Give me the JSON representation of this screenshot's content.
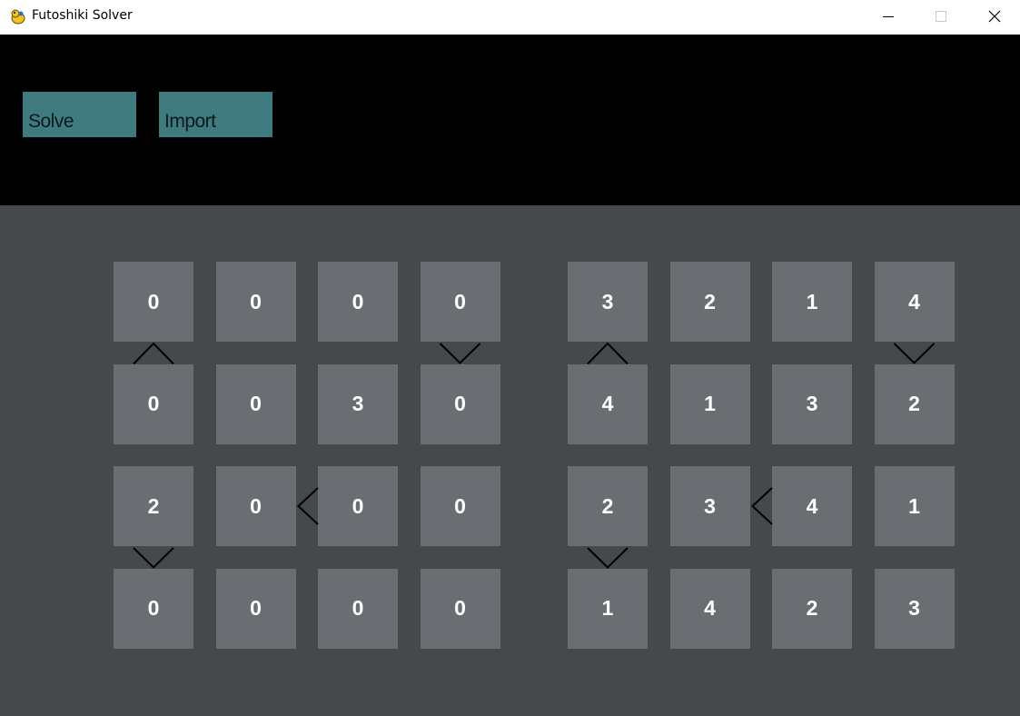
{
  "window": {
    "title": "Futoshiki Solver",
    "icon": "pygame-snake-icon",
    "controls": [
      "minimize-icon",
      "maximize-icon",
      "close-icon"
    ]
  },
  "toolbar": {
    "solve_label": "Solve",
    "import_label": "Import",
    "button_color": "#3f7a7f"
  },
  "colors": {
    "toolbar_bg": "#000000",
    "board_bg": "#45494c",
    "cell_bg": "#6a6d71",
    "cell_text": "#ffffff"
  },
  "puzzle": {
    "cells": [
      [
        "0",
        "0",
        "0",
        "0"
      ],
      [
        "0",
        "0",
        "3",
        "0"
      ],
      [
        "2",
        "0",
        "0",
        "0"
      ],
      [
        "0",
        "0",
        "0",
        "0"
      ]
    ]
  },
  "solution": {
    "cells": [
      [
        "3",
        "2",
        "1",
        "4"
      ],
      [
        "4",
        "1",
        "3",
        "2"
      ],
      [
        "2",
        "3",
        "4",
        "1"
      ],
      [
        "1",
        "4",
        "2",
        "3"
      ]
    ]
  },
  "constraints": [
    {
      "type": "vertical",
      "row": 0,
      "col": 0,
      "symbol": "^"
    },
    {
      "type": "vertical",
      "row": 0,
      "col": 3,
      "symbol": "v"
    },
    {
      "type": "horizontal",
      "row": 2,
      "col": 1,
      "symbol": "<"
    },
    {
      "type": "vertical",
      "row": 2,
      "col": 0,
      "symbol": "v"
    }
  ]
}
